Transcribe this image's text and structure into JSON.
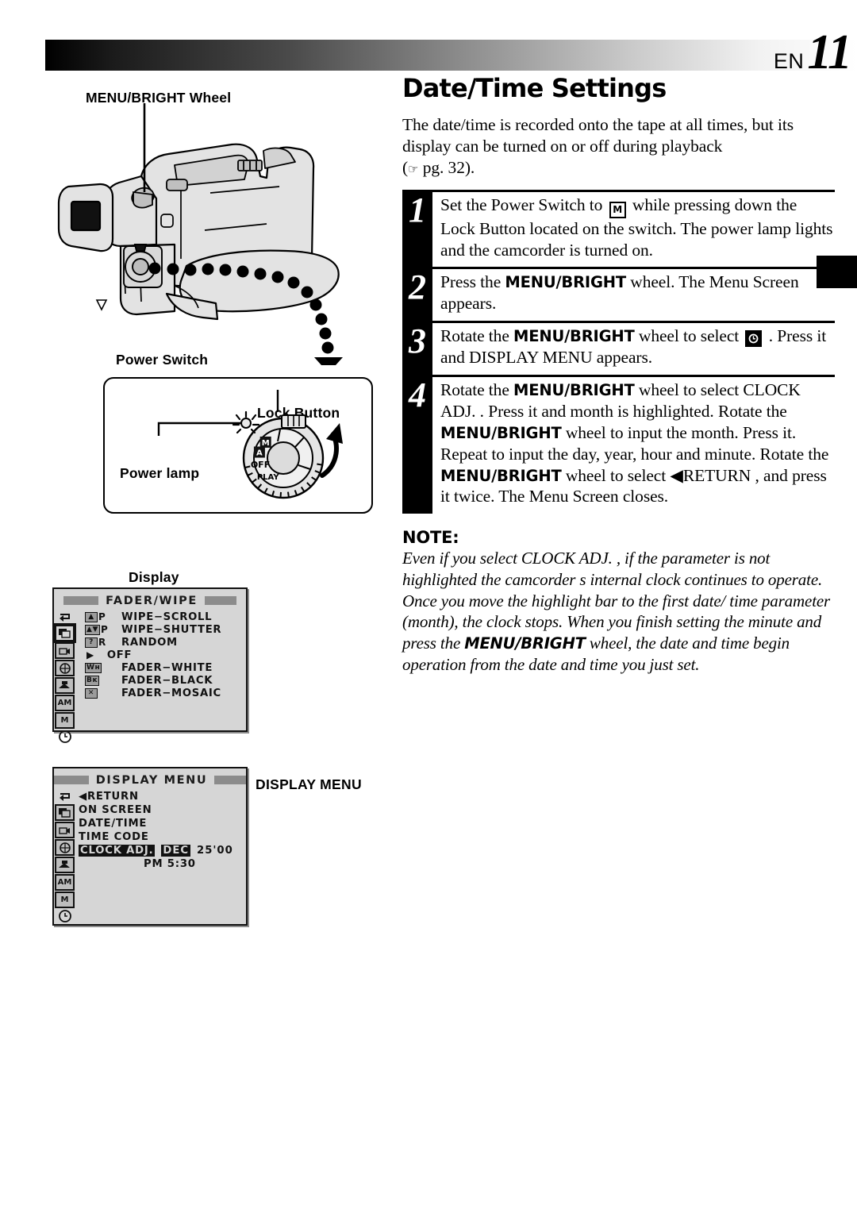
{
  "header": {
    "lang": "EN",
    "page_number": "11",
    "gradient_from": "#000000",
    "gradient_to": "#ffffff"
  },
  "title": "Date/Time Settings",
  "intro": {
    "line1": "The date/time is recorded onto the tape at all times, but its",
    "line2": "display can be turned on or off during playback",
    "ref_icon": "pointing-hand-icon",
    "ref_text": "pg. 32)."
  },
  "steps": [
    {
      "number": "1",
      "text_a": "Set the Power Switch to",
      "glyph": "M",
      "text_b": "while pressing down the Lock Button located on the switch. The power lamp lights and the camcorder is turned on."
    },
    {
      "number": "2",
      "text_a": "Press the",
      "bold": "MENU/BRIGHT",
      "text_b": "wheel. The Menu Screen appears."
    },
    {
      "number": "3",
      "text_a": "Rotate the",
      "bold": "MENU/BRIGHT",
      "text_b": "wheel to select",
      "glyph": "clock-icon",
      "text_c": ". Press it and  DISPLAY MENU  appears."
    },
    {
      "number": "4",
      "seg1_a": "Rotate the",
      "seg1_bold": "MENU/BRIGHT",
      "seg1_b": "wheel to select  CLOCK ADJ. . Press it and  month  is highlighted.",
      "seg2_a": "Rotate the",
      "seg2_bold": "MENU/BRIGHT",
      "seg2_b": "wheel to input the month. Press it. Repeat to input the day, year, hour and minute. Rotate the",
      "seg3_bold": "MENU/BRIGHT",
      "seg3_b": "wheel to select",
      "seg4": "◀RETURN , and press it twice. The Menu Screen closes."
    }
  ],
  "note": {
    "heading": "NOTE:",
    "part1": "Even if you select  CLOCK ADJ. , if the parameter is not highlighted the camcorder s internal clock continues to operate. Once you move the highlight bar to the first date/ time parameter (month), the clock stops. When you finish setting the minute and press the",
    "bold": "MENU/BRIGHT",
    "part2": "wheel, the date and time begin operation from the date and time you just set."
  },
  "figures": {
    "menu_wheel_label": "MENU/BRIGHT Wheel",
    "power_switch_label": "Power Switch",
    "display_label": "Display",
    "display_menu_callout": "DISPLAY MENU",
    "dial": {
      "lock_button_label": "Lock Button",
      "power_lamp_label": "Power lamp",
      "positions": [
        "M",
        "A",
        "OFF",
        "PLAY"
      ]
    }
  },
  "lcd_fader": {
    "title": "FADER/WIPE",
    "rail_icons": [
      "return-icon",
      "wipe-icon",
      "camera-icon",
      "effect-icon",
      "fade-icon",
      "am-icon",
      "m-icon",
      "clock-icon"
    ],
    "rail_selected_index": 1,
    "items": [
      {
        "icon": "▲",
        "suffix": "P",
        "label": "WIPE−SCROLL",
        "cursor": false
      },
      {
        "icon": "▲▼",
        "suffix": "P",
        "label": "WIPE−SHUTTER",
        "cursor": false
      },
      {
        "icon": "?",
        "suffix": "R",
        "label": "RANDOM",
        "cursor": false
      },
      {
        "icon": "",
        "suffix": "",
        "label": "OFF",
        "cursor": true
      },
      {
        "icon": "Wʜ",
        "suffix": "",
        "label": "FADER−WHITE",
        "cursor": false
      },
      {
        "icon": "Bᴋ",
        "suffix": "",
        "label": "FADER−BLACK",
        "cursor": false
      },
      {
        "icon": "✕",
        "suffix": "",
        "label": "FADER−MOSAIC",
        "cursor": false
      }
    ]
  },
  "lcd_display_menu": {
    "title": "DISPLAY MENU",
    "rail_icons": [
      "return-icon",
      "wipe-icon",
      "camera-icon",
      "effect-icon",
      "fade-icon",
      "am-icon",
      "m-icon",
      "clock-icon"
    ],
    "rail_selected_index": 7,
    "items": [
      {
        "label": "◀RETURN",
        "highlighted": false,
        "value": ""
      },
      {
        "label": "ON  SCREEN",
        "highlighted": false,
        "value": ""
      },
      {
        "label": "DATE/TIME",
        "highlighted": false,
        "value": ""
      },
      {
        "label": "TIME  CODE",
        "highlighted": false,
        "value": ""
      },
      {
        "label": "CLOCK ADJ.",
        "highlighted": true,
        "value_hl": "DEC",
        "value": "25'00"
      },
      {
        "label": "",
        "highlighted": false,
        "value": "PM   5:30"
      }
    ]
  }
}
